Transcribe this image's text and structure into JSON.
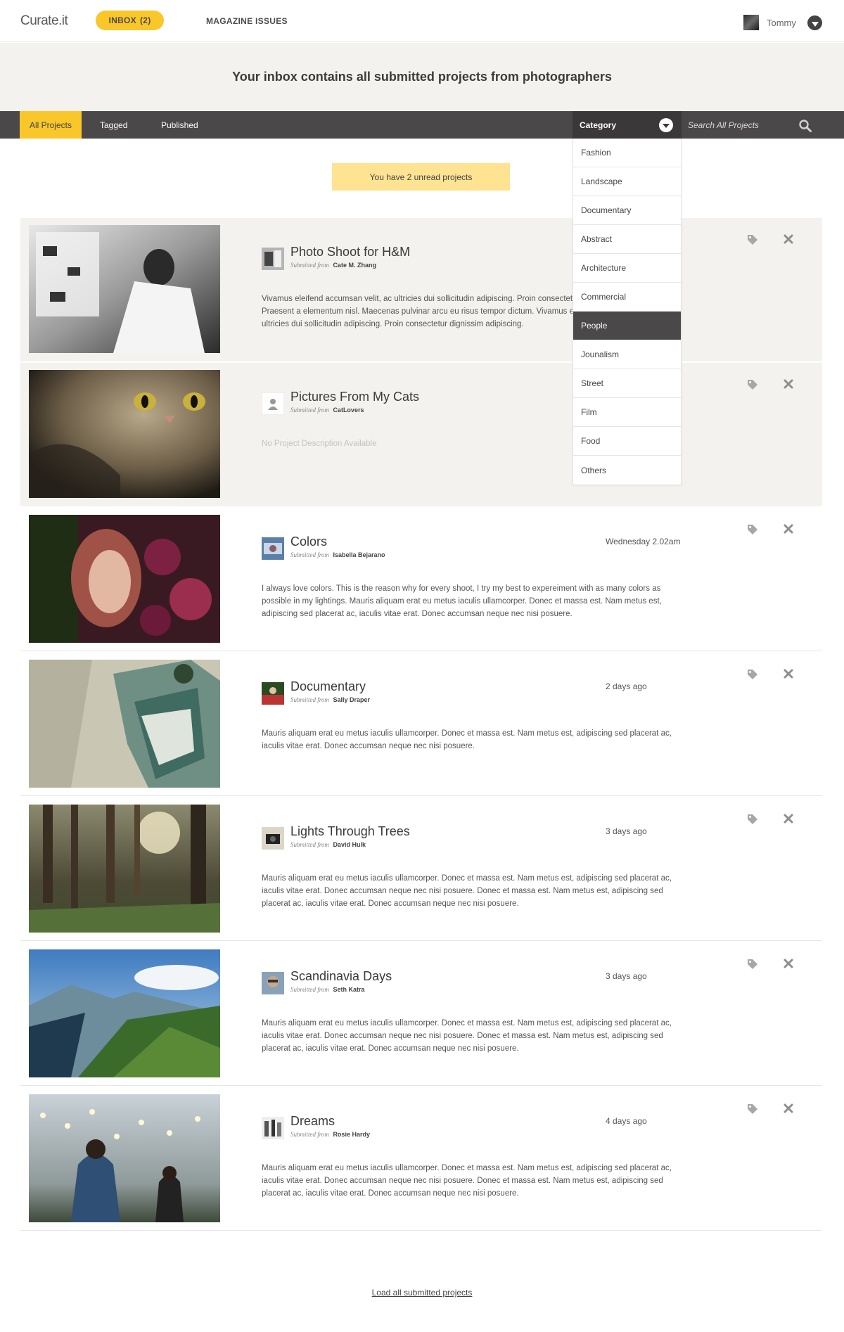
{
  "app": {
    "logo": "Curate.it",
    "nav": {
      "inbox_label": "INBOX",
      "inbox_count": "(2)",
      "magazine_label": "MAGAZINE ISSUES"
    },
    "user": {
      "name": "Tommy"
    }
  },
  "hero": {
    "text": "Your inbox contains all submitted projects from photographers"
  },
  "filters": {
    "tabs": [
      "All Projects",
      "Tagged",
      "Published"
    ],
    "active_tab": "All Projects",
    "category_label": "Category",
    "search_placeholder": "Search All Projects"
  },
  "unread_banner": "You have 2 unread projects",
  "submitted_label": "Submitted from",
  "projects": [
    {
      "title": "Photo Shoot for H&M",
      "submitter": "Cate M. Zhang",
      "time": "",
      "description": "Vivamus eleifend accumsan velit, ac ultricies dui sollicitudin adipiscing. Proin consectetur dignissim adipiscing. Praesent a elementum nisl. Maecenas pulvinar arcu eu risus tempor dictum. Vivamus eleifend accumsan velit, ac ultricies dui sollicitudin adipiscing. Proin consectetur dignissim adipiscing.",
      "unread": true
    },
    {
      "title": "Pictures From My Cats",
      "submitter": "CatLovers",
      "time": "",
      "description": "No Project Description Available",
      "unread": true
    },
    {
      "title": "Colors",
      "submitter": "Isabella Bejarano",
      "time": "Wednesday 2.02am",
      "description": "I always love colors. This is the reason why for every shoot, I try my best to expereiment with as many colors as possible in my lightings. Mauris aliquam erat eu metus iaculis ullamcorper. Donec et massa est. Nam metus est, adipiscing sed placerat ac, iaculis vitae erat. Donec accumsan neque nec nisi posuere.",
      "unread": false
    },
    {
      "title": "Documentary",
      "submitter": "Sally Draper",
      "time": "2 days ago",
      "description": "Mauris aliquam erat eu metus iaculis ullamcorper. Donec et massa est. Nam metus est, adipiscing sed placerat ac, iaculis vitae erat. Donec accumsan neque nec nisi posuere.",
      "unread": false
    },
    {
      "title": "Lights Through Trees",
      "submitter": "David Hulk",
      "time": "3 days ago",
      "description": "Mauris aliquam erat eu metus iaculis ullamcorper. Donec et massa est. Nam metus est, adipiscing sed placerat ac, iaculis vitae erat. Donec accumsan neque nec nisi posuere. Donec et massa est. Nam metus est, adipiscing sed placerat ac, iaculis vitae erat. Donec accumsan neque nec nisi posuere.",
      "unread": false
    },
    {
      "title": "Scandinavia Days",
      "submitter": "Seth Katra",
      "time": "3 days ago",
      "description": "Mauris aliquam erat eu metus iaculis ullamcorper. Donec et massa est. Nam metus est, adipiscing sed placerat ac, iaculis vitae erat. Donec accumsan neque nec nisi posuere. Donec et massa est. Nam metus est, adipiscing sed placerat ac, iaculis vitae erat. Donec accumsan neque nec nisi posuere.",
      "unread": false
    },
    {
      "title": "Dreams",
      "submitter": "Rosie Hardy",
      "time": "4 days ago",
      "description": "Mauris aliquam erat eu metus iaculis ullamcorper. Donec et massa est. Nam metus est, adipiscing sed placerat ac, iaculis vitae erat. Donec accumsan neque nec nisi posuere. Donec et massa est. Nam metus est, adipiscing sed placerat ac, iaculis vitae erat. Donec accumsan neque nec nisi posuere.",
      "unread": false
    }
  ],
  "category_dropdown": {
    "items": [
      "Fashion",
      "Landscape",
      "Documentary",
      "Abstract",
      "Architecture",
      "Commercial",
      "People",
      "Jounalism",
      "Street",
      "Film",
      "Food",
      "Others"
    ],
    "selected": "People"
  },
  "load_more": "Load all submitted projects",
  "icons": {
    "row_actions": [
      "tag-icon",
      "close-icon"
    ],
    "search": "search-icon",
    "user_menu": "chevron-down-icon"
  },
  "colors": {
    "accent": "#f9c72a",
    "banner": "#fde392",
    "bar": "#4a4848",
    "shaded_row": "#f3f2ee"
  }
}
